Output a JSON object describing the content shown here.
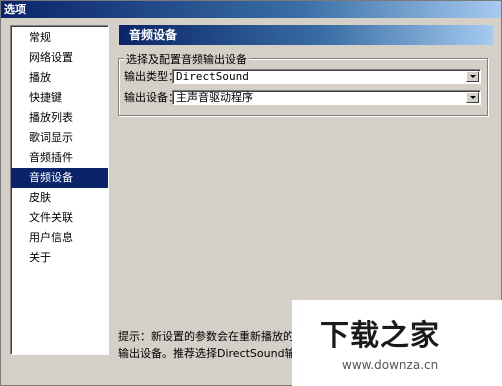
{
  "window": {
    "title": "选项"
  },
  "sidebar": {
    "items": [
      {
        "label": "常规"
      },
      {
        "label": "网络设置"
      },
      {
        "label": "播放"
      },
      {
        "label": "快捷键"
      },
      {
        "label": "播放列表"
      },
      {
        "label": "歌词显示"
      },
      {
        "label": "音频插件"
      },
      {
        "label": "音频设备",
        "selected": true
      },
      {
        "label": "皮肤"
      },
      {
        "label": "文件关联"
      },
      {
        "label": "用户信息"
      },
      {
        "label": "关于"
      }
    ]
  },
  "main": {
    "header": "音频设备",
    "group": {
      "title": "选择及配置音频输出设备",
      "output_type": {
        "label": "输出类型：",
        "value": "DirectSound"
      },
      "output_device": {
        "label": "输出设备：",
        "value": "主声音驱动程序"
      }
    },
    "hint": {
      "line1": "提示：新设置的参数会在重新播放的时候生",
      "line2": "输出设备。推荐选择DirectSound输出类型"
    }
  },
  "watermark": {
    "logo": "下载之家",
    "url": "www.downza.cn"
  },
  "colors": {
    "selection": "#0a246a",
    "header_start": "#0a246a",
    "header_end": "#a6caf0",
    "dialog_bg": "#d4d0c8"
  }
}
